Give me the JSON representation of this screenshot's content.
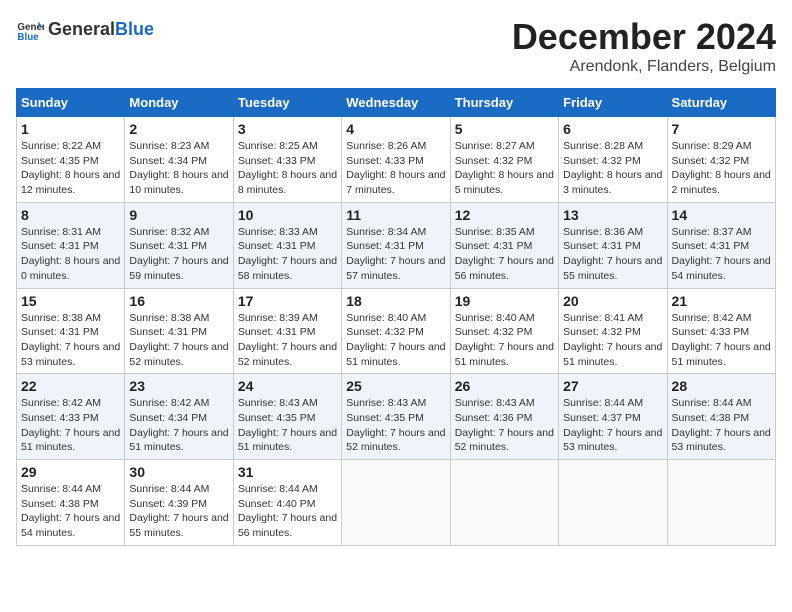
{
  "header": {
    "logo_general": "General",
    "logo_blue": "Blue",
    "main_title": "December 2024",
    "subtitle": "Arendonk, Flanders, Belgium"
  },
  "calendar": {
    "weekdays": [
      "Sunday",
      "Monday",
      "Tuesday",
      "Wednesday",
      "Thursday",
      "Friday",
      "Saturday"
    ],
    "weeks": [
      [
        {
          "day": "",
          "sunrise": "",
          "sunset": "",
          "daylight": "",
          "empty": true
        },
        {
          "day": "",
          "sunrise": "",
          "sunset": "",
          "daylight": "",
          "empty": true
        },
        {
          "day": "",
          "sunrise": "",
          "sunset": "",
          "daylight": "",
          "empty": true
        },
        {
          "day": "",
          "sunrise": "",
          "sunset": "",
          "daylight": "",
          "empty": true
        },
        {
          "day": "",
          "sunrise": "",
          "sunset": "",
          "daylight": "",
          "empty": true
        },
        {
          "day": "",
          "sunrise": "",
          "sunset": "",
          "daylight": "",
          "empty": true
        },
        {
          "day": "",
          "sunrise": "",
          "sunset": "",
          "daylight": "",
          "empty": true
        }
      ],
      [
        {
          "day": "1",
          "sunrise": "Sunrise: 8:22 AM",
          "sunset": "Sunset: 4:35 PM",
          "daylight": "Daylight: 8 hours and 12 minutes.",
          "empty": false
        },
        {
          "day": "2",
          "sunrise": "Sunrise: 8:23 AM",
          "sunset": "Sunset: 4:34 PM",
          "daylight": "Daylight: 8 hours and 10 minutes.",
          "empty": false
        },
        {
          "day": "3",
          "sunrise": "Sunrise: 8:25 AM",
          "sunset": "Sunset: 4:33 PM",
          "daylight": "Daylight: 8 hours and 8 minutes.",
          "empty": false
        },
        {
          "day": "4",
          "sunrise": "Sunrise: 8:26 AM",
          "sunset": "Sunset: 4:33 PM",
          "daylight": "Daylight: 8 hours and 7 minutes.",
          "empty": false
        },
        {
          "day": "5",
          "sunrise": "Sunrise: 8:27 AM",
          "sunset": "Sunset: 4:32 PM",
          "daylight": "Daylight: 8 hours and 5 minutes.",
          "empty": false
        },
        {
          "day": "6",
          "sunrise": "Sunrise: 8:28 AM",
          "sunset": "Sunset: 4:32 PM",
          "daylight": "Daylight: 8 hours and 3 minutes.",
          "empty": false
        },
        {
          "day": "7",
          "sunrise": "Sunrise: 8:29 AM",
          "sunset": "Sunset: 4:32 PM",
          "daylight": "Daylight: 8 hours and 2 minutes.",
          "empty": false
        }
      ],
      [
        {
          "day": "8",
          "sunrise": "Sunrise: 8:31 AM",
          "sunset": "Sunset: 4:31 PM",
          "daylight": "Daylight: 8 hours and 0 minutes.",
          "empty": false
        },
        {
          "day": "9",
          "sunrise": "Sunrise: 8:32 AM",
          "sunset": "Sunset: 4:31 PM",
          "daylight": "Daylight: 7 hours and 59 minutes.",
          "empty": false
        },
        {
          "day": "10",
          "sunrise": "Sunrise: 8:33 AM",
          "sunset": "Sunset: 4:31 PM",
          "daylight": "Daylight: 7 hours and 58 minutes.",
          "empty": false
        },
        {
          "day": "11",
          "sunrise": "Sunrise: 8:34 AM",
          "sunset": "Sunset: 4:31 PM",
          "daylight": "Daylight: 7 hours and 57 minutes.",
          "empty": false
        },
        {
          "day": "12",
          "sunrise": "Sunrise: 8:35 AM",
          "sunset": "Sunset: 4:31 PM",
          "daylight": "Daylight: 7 hours and 56 minutes.",
          "empty": false
        },
        {
          "day": "13",
          "sunrise": "Sunrise: 8:36 AM",
          "sunset": "Sunset: 4:31 PM",
          "daylight": "Daylight: 7 hours and 55 minutes.",
          "empty": false
        },
        {
          "day": "14",
          "sunrise": "Sunrise: 8:37 AM",
          "sunset": "Sunset: 4:31 PM",
          "daylight": "Daylight: 7 hours and 54 minutes.",
          "empty": false
        }
      ],
      [
        {
          "day": "15",
          "sunrise": "Sunrise: 8:38 AM",
          "sunset": "Sunset: 4:31 PM",
          "daylight": "Daylight: 7 hours and 53 minutes.",
          "empty": false
        },
        {
          "day": "16",
          "sunrise": "Sunrise: 8:38 AM",
          "sunset": "Sunset: 4:31 PM",
          "daylight": "Daylight: 7 hours and 52 minutes.",
          "empty": false
        },
        {
          "day": "17",
          "sunrise": "Sunrise: 8:39 AM",
          "sunset": "Sunset: 4:31 PM",
          "daylight": "Daylight: 7 hours and 52 minutes.",
          "empty": false
        },
        {
          "day": "18",
          "sunrise": "Sunrise: 8:40 AM",
          "sunset": "Sunset: 4:32 PM",
          "daylight": "Daylight: 7 hours and 51 minutes.",
          "empty": false
        },
        {
          "day": "19",
          "sunrise": "Sunrise: 8:40 AM",
          "sunset": "Sunset: 4:32 PM",
          "daylight": "Daylight: 7 hours and 51 minutes.",
          "empty": false
        },
        {
          "day": "20",
          "sunrise": "Sunrise: 8:41 AM",
          "sunset": "Sunset: 4:32 PM",
          "daylight": "Daylight: 7 hours and 51 minutes.",
          "empty": false
        },
        {
          "day": "21",
          "sunrise": "Sunrise: 8:42 AM",
          "sunset": "Sunset: 4:33 PM",
          "daylight": "Daylight: 7 hours and 51 minutes.",
          "empty": false
        }
      ],
      [
        {
          "day": "22",
          "sunrise": "Sunrise: 8:42 AM",
          "sunset": "Sunset: 4:33 PM",
          "daylight": "Daylight: 7 hours and 51 minutes.",
          "empty": false
        },
        {
          "day": "23",
          "sunrise": "Sunrise: 8:42 AM",
          "sunset": "Sunset: 4:34 PM",
          "daylight": "Daylight: 7 hours and 51 minutes.",
          "empty": false
        },
        {
          "day": "24",
          "sunrise": "Sunrise: 8:43 AM",
          "sunset": "Sunset: 4:35 PM",
          "daylight": "Daylight: 7 hours and 51 minutes.",
          "empty": false
        },
        {
          "day": "25",
          "sunrise": "Sunrise: 8:43 AM",
          "sunset": "Sunset: 4:35 PM",
          "daylight": "Daylight: 7 hours and 52 minutes.",
          "empty": false
        },
        {
          "day": "26",
          "sunrise": "Sunrise: 8:43 AM",
          "sunset": "Sunset: 4:36 PM",
          "daylight": "Daylight: 7 hours and 52 minutes.",
          "empty": false
        },
        {
          "day": "27",
          "sunrise": "Sunrise: 8:44 AM",
          "sunset": "Sunset: 4:37 PM",
          "daylight": "Daylight: 7 hours and 53 minutes.",
          "empty": false
        },
        {
          "day": "28",
          "sunrise": "Sunrise: 8:44 AM",
          "sunset": "Sunset: 4:38 PM",
          "daylight": "Daylight: 7 hours and 53 minutes.",
          "empty": false
        }
      ],
      [
        {
          "day": "29",
          "sunrise": "Sunrise: 8:44 AM",
          "sunset": "Sunset: 4:38 PM",
          "daylight": "Daylight: 7 hours and 54 minutes.",
          "empty": false
        },
        {
          "day": "30",
          "sunrise": "Sunrise: 8:44 AM",
          "sunset": "Sunset: 4:39 PM",
          "daylight": "Daylight: 7 hours and 55 minutes.",
          "empty": false
        },
        {
          "day": "31",
          "sunrise": "Sunrise: 8:44 AM",
          "sunset": "Sunset: 4:40 PM",
          "daylight": "Daylight: 7 hours and 56 minutes.",
          "empty": false
        },
        {
          "day": "",
          "sunrise": "",
          "sunset": "",
          "daylight": "",
          "empty": true
        },
        {
          "day": "",
          "sunrise": "",
          "sunset": "",
          "daylight": "",
          "empty": true
        },
        {
          "day": "",
          "sunrise": "",
          "sunset": "",
          "daylight": "",
          "empty": true
        },
        {
          "day": "",
          "sunrise": "",
          "sunset": "",
          "daylight": "",
          "empty": true
        }
      ]
    ]
  }
}
